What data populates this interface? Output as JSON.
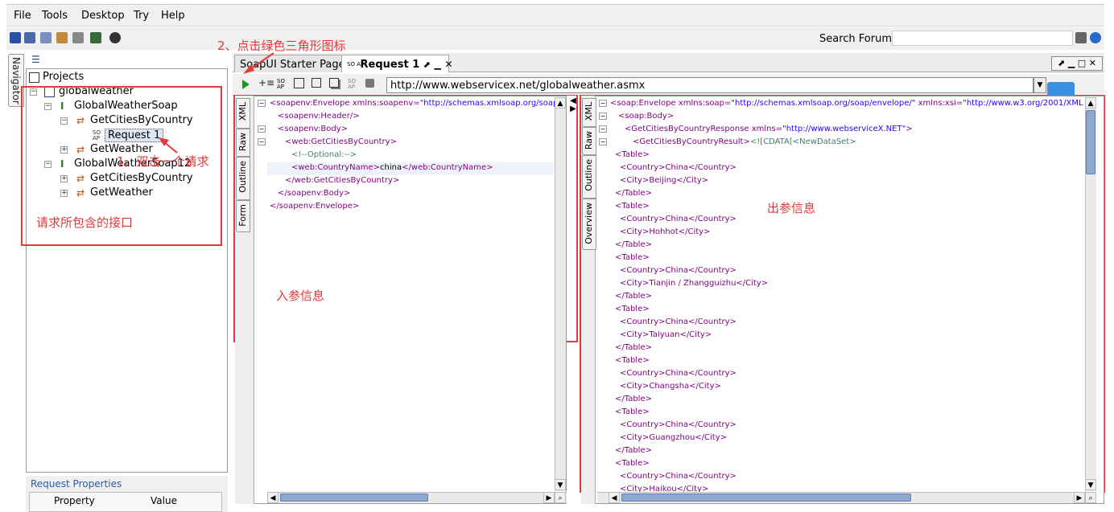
{
  "menu": {
    "file": "File",
    "tools": "Tools",
    "desktop": "Desktop",
    "try": "Try",
    "help": "Help"
  },
  "search": {
    "label": "Search Forum",
    "value": ""
  },
  "navigator": {
    "tab_label": "Navigator",
    "root": "Projects"
  },
  "tree": {
    "project": "globalweather",
    "binding1": "GlobalWeatherSoap",
    "op1": "GetCitiesByCountry",
    "request": "Request 1",
    "op2": "GetWeather",
    "binding2": "GlobalWeatherSoap12",
    "op3": "GetCitiesByCountry",
    "op4": "GetWeather"
  },
  "props": {
    "title": "Request Properties",
    "col1": "Property",
    "col2": "Value"
  },
  "annotations": {
    "step1": "1、双击一个请求",
    "step2": "2、点击绿色三角形图标",
    "interfaces": "请求所包含的接口",
    "input": "入参信息",
    "output": "出参信息"
  },
  "tabs": {
    "starter": "SoapUI Starter Page",
    "request": "Request 1"
  },
  "endpoint": "http://www.webservicex.net/globalweather.asmx",
  "request_tabs": [
    "XML",
    "Raw",
    "Outline",
    "Form"
  ],
  "response_tabs": [
    "XML",
    "Raw",
    "Outline",
    "Overview"
  ],
  "request_xml": {
    "l1_tag": "<soapenv:Envelope",
    "l1_attr": " xmlns:soapenv=",
    "l1_val": "\"http://schemas.xmlsoap.org/soap/en",
    "l2": "<soapenv:Header/>",
    "l3": "<soapenv:Body>",
    "l4": "<web:GetCitiesByCountry>",
    "l5": "<!--Optional:-->",
    "l6_open": "<web:CountryName>",
    "l6_text": "china",
    "l6_close": "</web:CountryName>",
    "l7": "</web:GetCitiesByCountry>",
    "l8": "</soapenv:Body>",
    "l9": "</soapenv:Envelope>"
  },
  "response_xml": {
    "l1_tag": "<soap:Envelope",
    "l1_attr1": " xmlns:soap=",
    "l1_val1": "\"http://schemas.xmlsoap.org/soap/envelope/\"",
    "l1_attr2": " xmlns:xsi=",
    "l1_val2": "\"http://www.w3.org/2001/XMLSchem",
    "l2": "<soap:Body>",
    "l3_tag": "<GetCitiesByCountryResponse",
    "l3_attr": " xmlns=",
    "l3_val": "\"http://www.webserviceX.NET\"",
    "l3_end": ">",
    "l4_tag": "<GetCitiesByCountryResult>",
    "l4_text": "<![CDATA[<NewDataSet>",
    "lines": [
      "<Table>",
      "<Country>China</Country>",
      "<City>Beijing</City>",
      "</Table>",
      "<Table>",
      "<Country>China</Country>",
      "<City>Hohhot</City>",
      "</Table>",
      "<Table>",
      "<Country>China</Country>",
      "<City>Tianjin / Zhangguizhu</City>",
      "</Table>",
      "<Table>",
      "<Country>China</Country>",
      "<City>Taiyuan</City>",
      "</Table>",
      "<Table>",
      "<Country>China</Country>",
      "<City>Changsha</City>",
      "</Table>",
      "<Table>",
      "<Country>China</Country>",
      "<City>Guangzhou</City>",
      "</Table>",
      "<Table>",
      "<Country>China</Country>",
      "<City>Haikou</City>"
    ]
  },
  "colors": {
    "annotation": "#e23a3a",
    "run_button": "#1a9a1a",
    "scroll_thumb": "#8fa8d0"
  },
  "icons": [
    "run-icon",
    "add-icon",
    "stop-icon",
    "search-icon",
    "help-icon"
  ]
}
